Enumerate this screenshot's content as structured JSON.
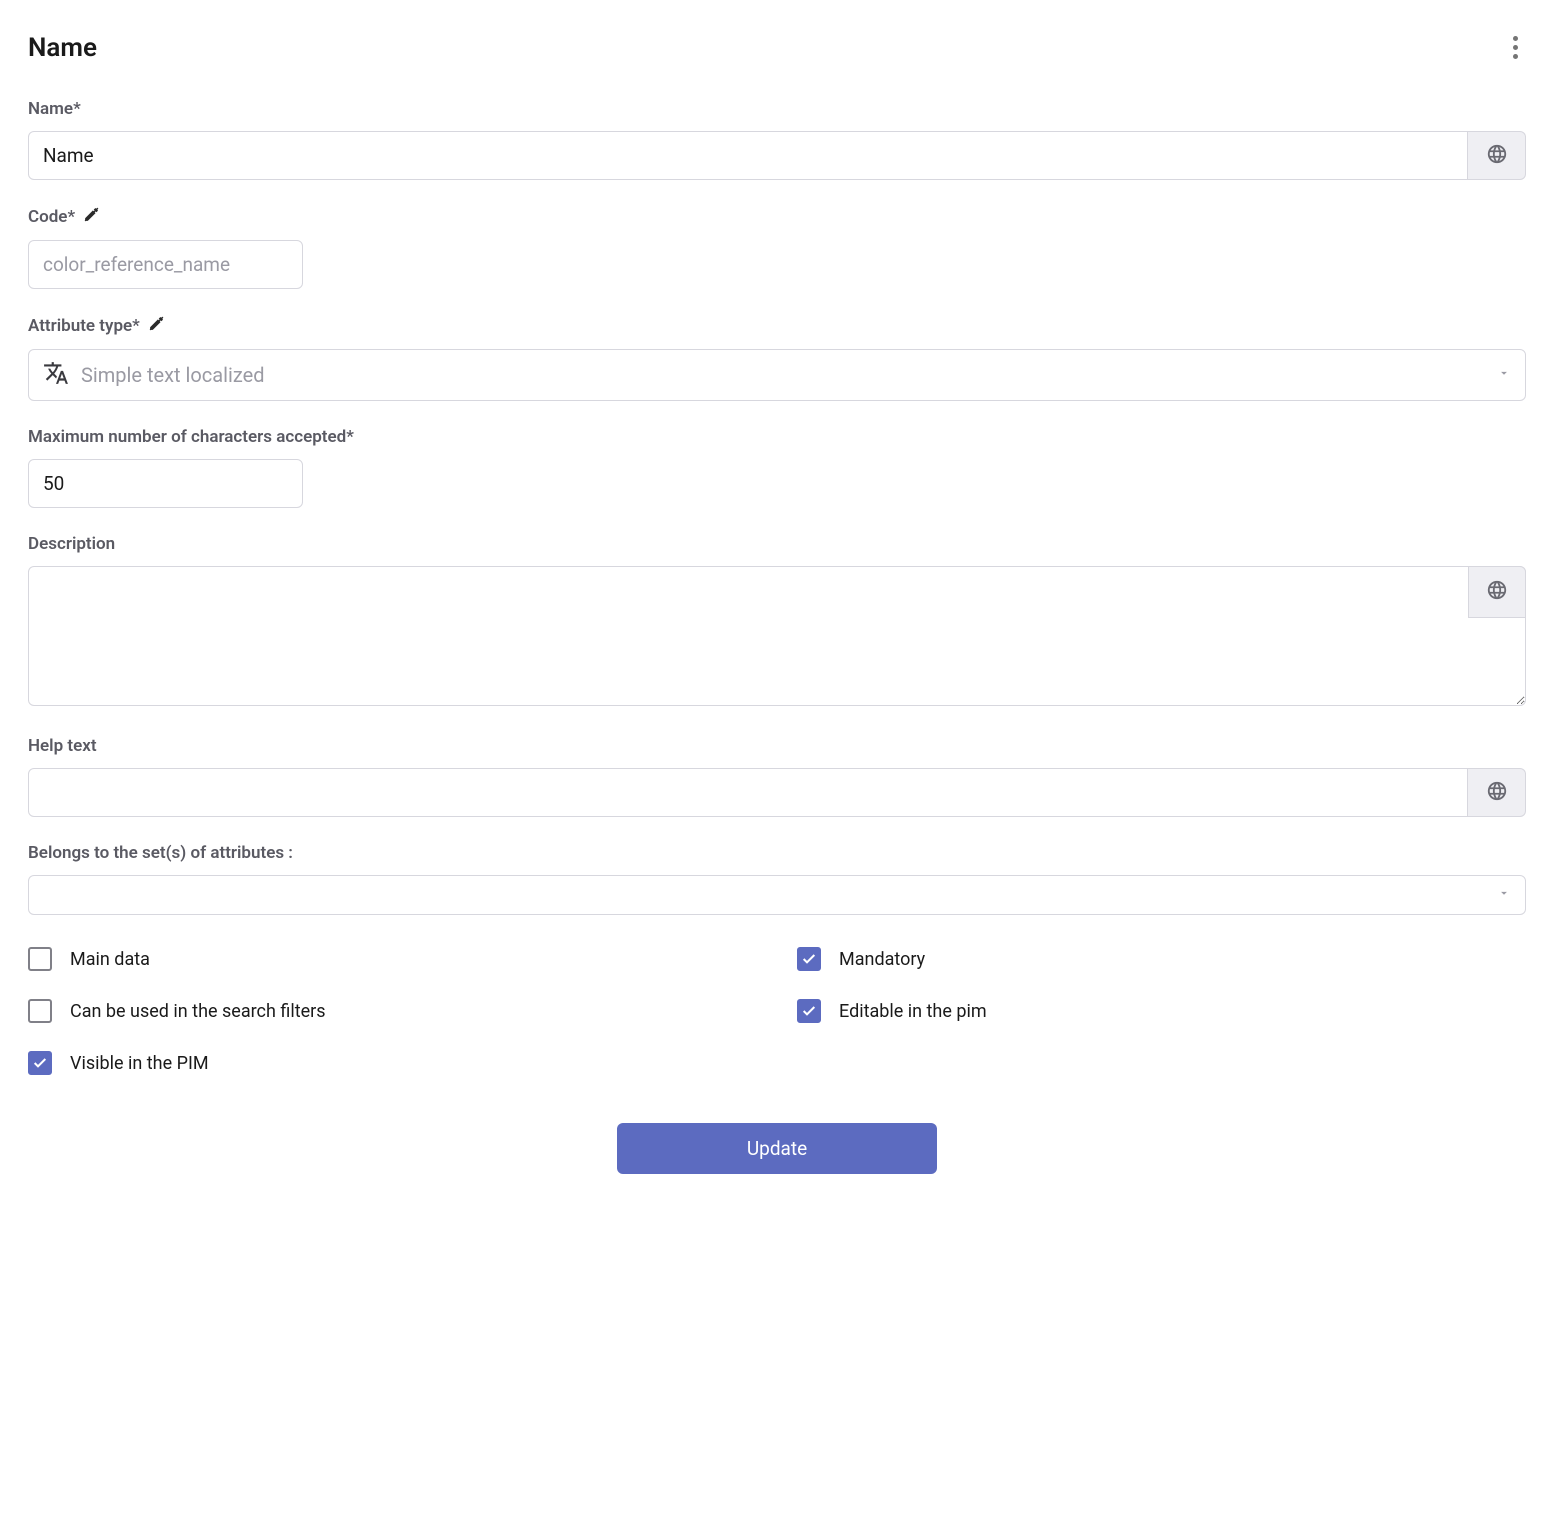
{
  "header": {
    "title": "Name"
  },
  "fields": {
    "name": {
      "label": "Name*",
      "value": "Name"
    },
    "code": {
      "label": "Code*",
      "placeholder": "color_reference_name",
      "value": ""
    },
    "attribute_type": {
      "label": "Attribute type*",
      "selected": "Simple text localized"
    },
    "max_chars": {
      "label": "Maximum number of characters accepted*",
      "value": "50"
    },
    "description": {
      "label": "Description",
      "value": ""
    },
    "help_text": {
      "label": "Help text",
      "value": ""
    },
    "belongs_to": {
      "label": "Belongs to the set(s) of attributes :",
      "selected": ""
    }
  },
  "checkboxes": {
    "main_data": {
      "label": "Main data",
      "checked": false
    },
    "mandatory": {
      "label": "Mandatory",
      "checked": true
    },
    "search_filters": {
      "label": "Can be used in the search filters",
      "checked": false
    },
    "editable_pim": {
      "label": "Editable in the pim",
      "checked": true
    },
    "visible_pim": {
      "label": "Visible in the PIM",
      "checked": true
    }
  },
  "actions": {
    "submit": "Update"
  },
  "colors": {
    "primary": "#5c6bc0"
  }
}
